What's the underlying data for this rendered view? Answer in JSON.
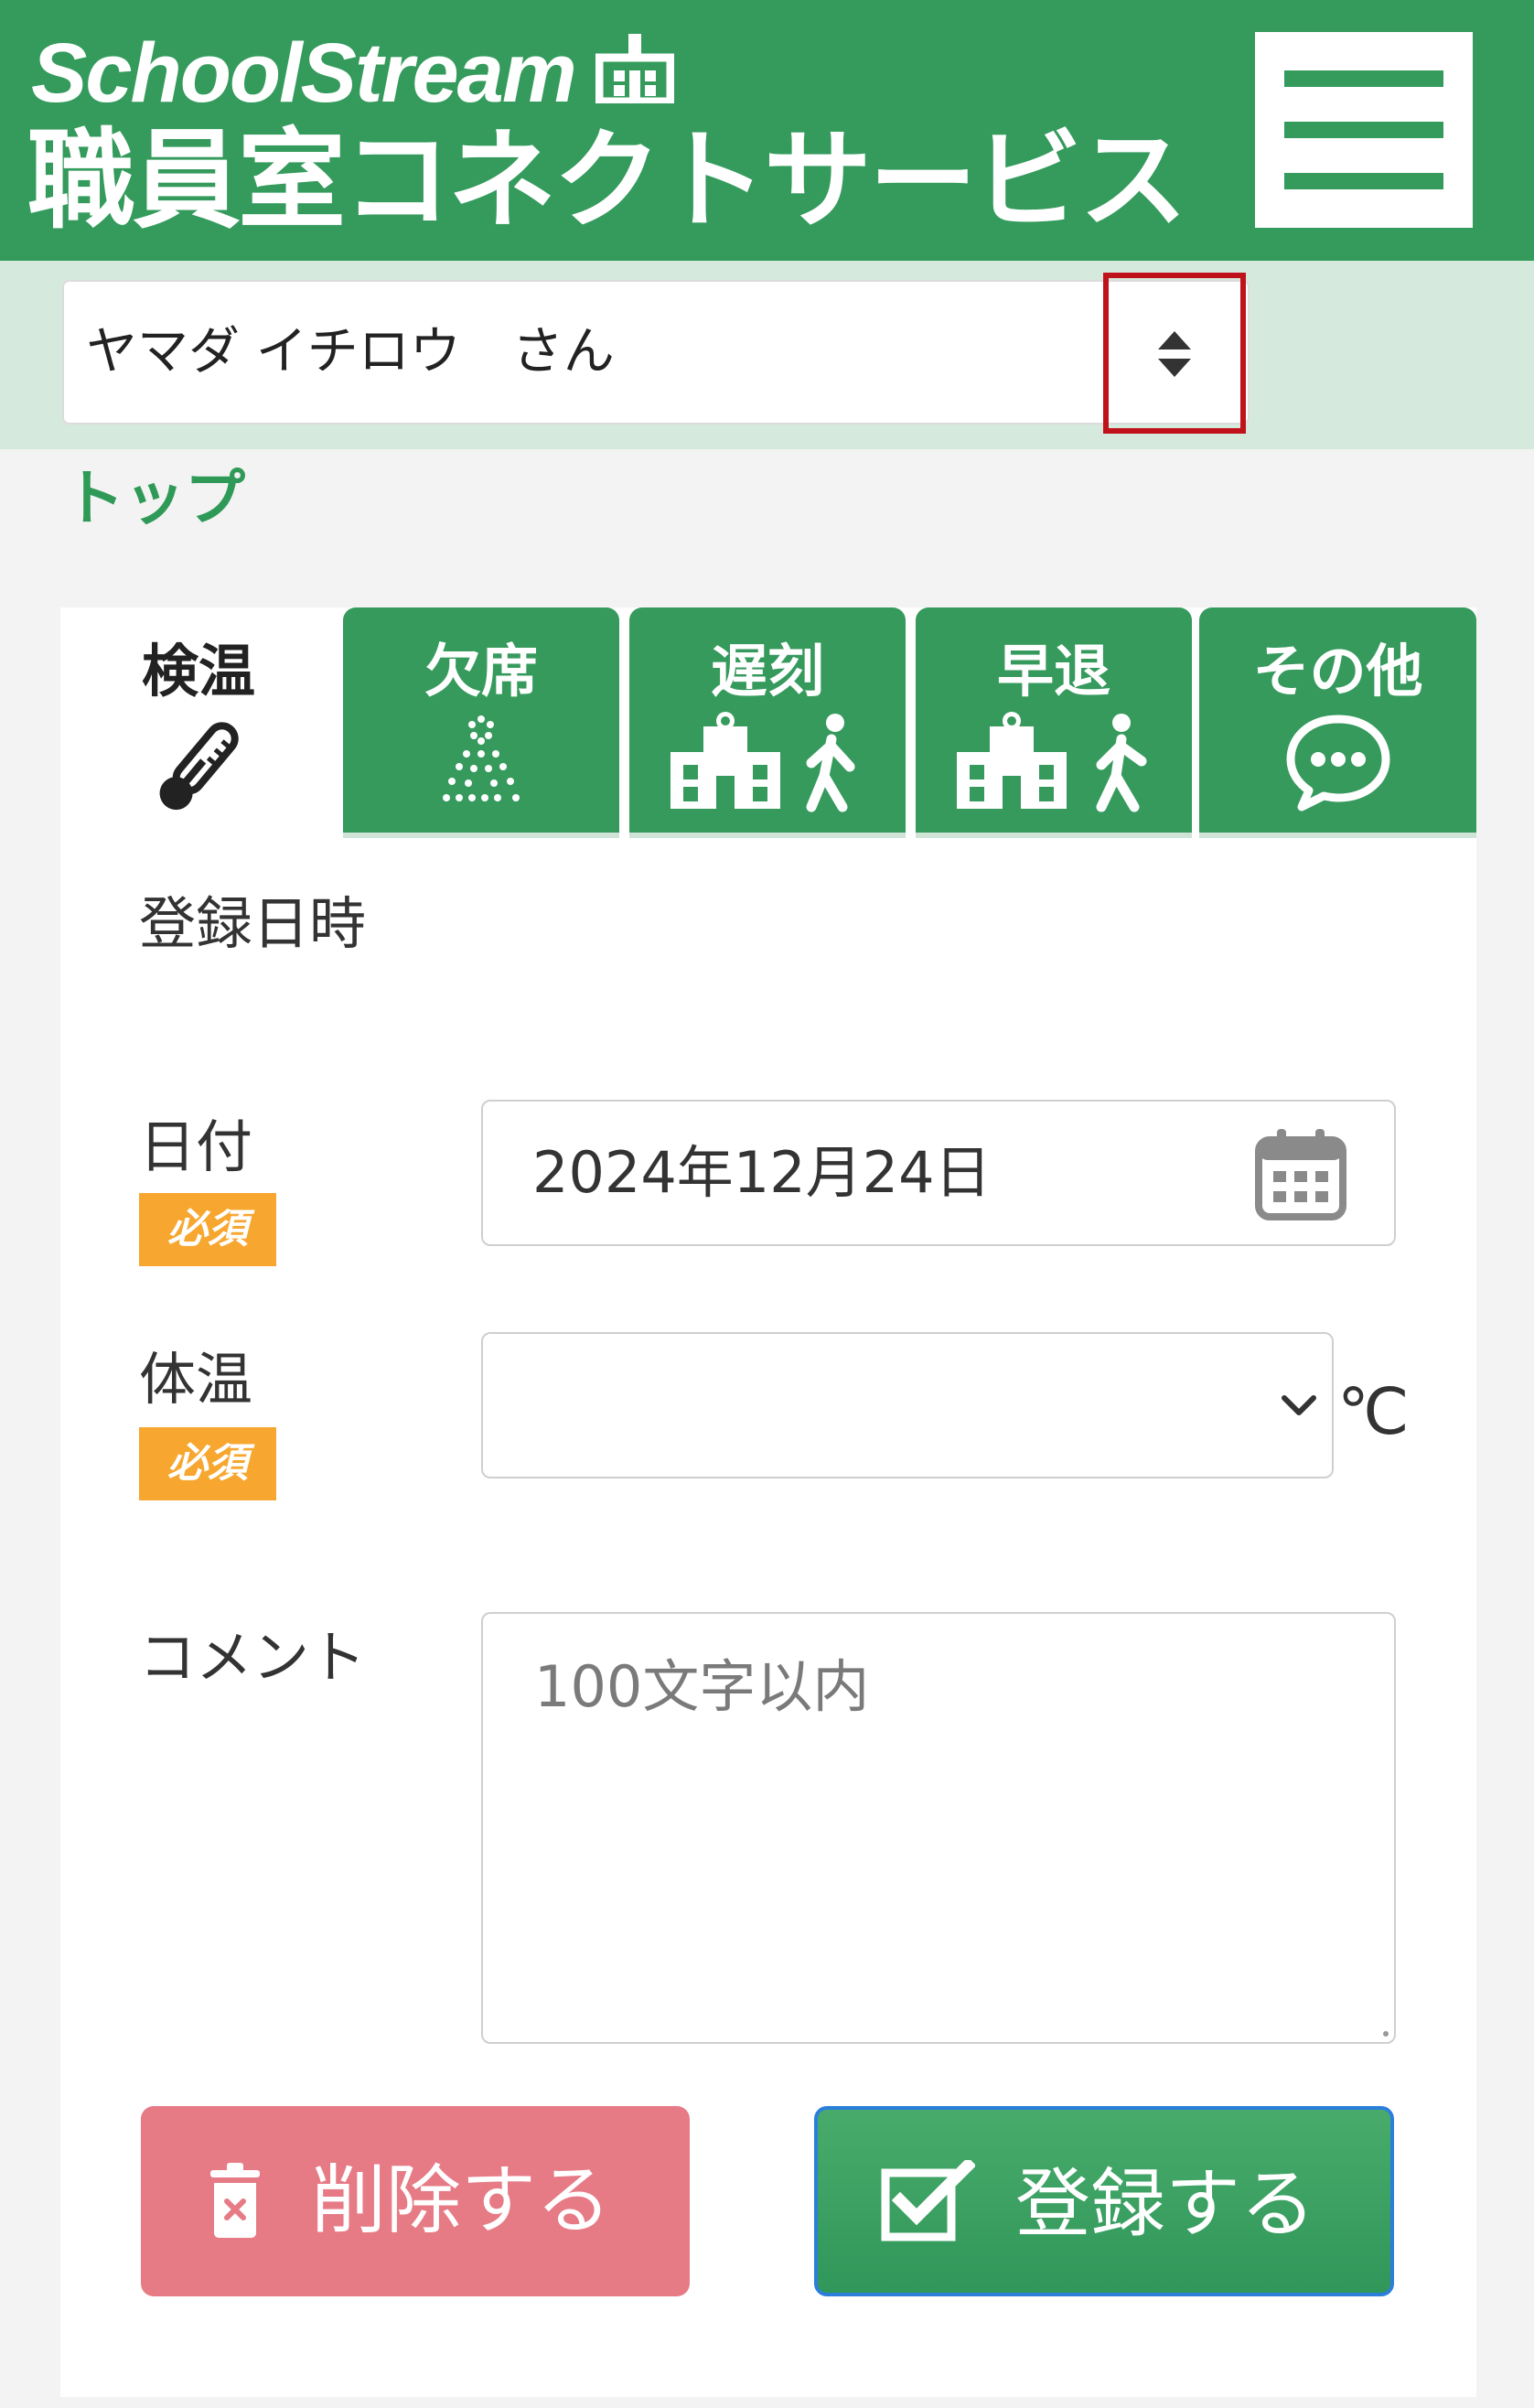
{
  "header": {
    "brand_en": "SchoolStream",
    "brand_jp": "職員室コネクトサービス",
    "logo_icon": "school-building-icon",
    "menu_icon": "hamburger-menu-icon"
  },
  "user": {
    "name": "ヤマダ イチロウ　さん",
    "sort_icon": "sort-updown-icon"
  },
  "breadcrumb": {
    "current": "トップ"
  },
  "tabs": [
    {
      "label": "検温",
      "icon": "thermometer-icon",
      "active": true
    },
    {
      "label": "欠席",
      "icon": "dotted-person-icon",
      "active": false
    },
    {
      "label": "遅刻",
      "icon": "school-walk-in-icon",
      "active": false
    },
    {
      "label": "早退",
      "icon": "school-walk-out-icon",
      "active": false
    },
    {
      "label": "その他",
      "icon": "speech-bubble-icon",
      "active": false
    }
  ],
  "form": {
    "section_title": "登録日時",
    "date": {
      "label": "日付",
      "required": "必須",
      "value": "2024年12月24日",
      "icon": "calendar-icon"
    },
    "temperature": {
      "label": "体温",
      "required": "必須",
      "value": "",
      "unit": "℃"
    },
    "comment": {
      "label": "コメント",
      "placeholder": "100文字以内",
      "value": ""
    }
  },
  "actions": {
    "delete_label": "削除する",
    "submit_label": "登録する",
    "delete_icon": "trash-icon",
    "submit_icon": "checkbox-icon"
  },
  "colors": {
    "brand_green": "#349b5c",
    "light_green": "#d6e9dd",
    "required_orange": "#f7a72f",
    "delete_pink": "#e67b86",
    "highlight_red": "#c0121b"
  }
}
